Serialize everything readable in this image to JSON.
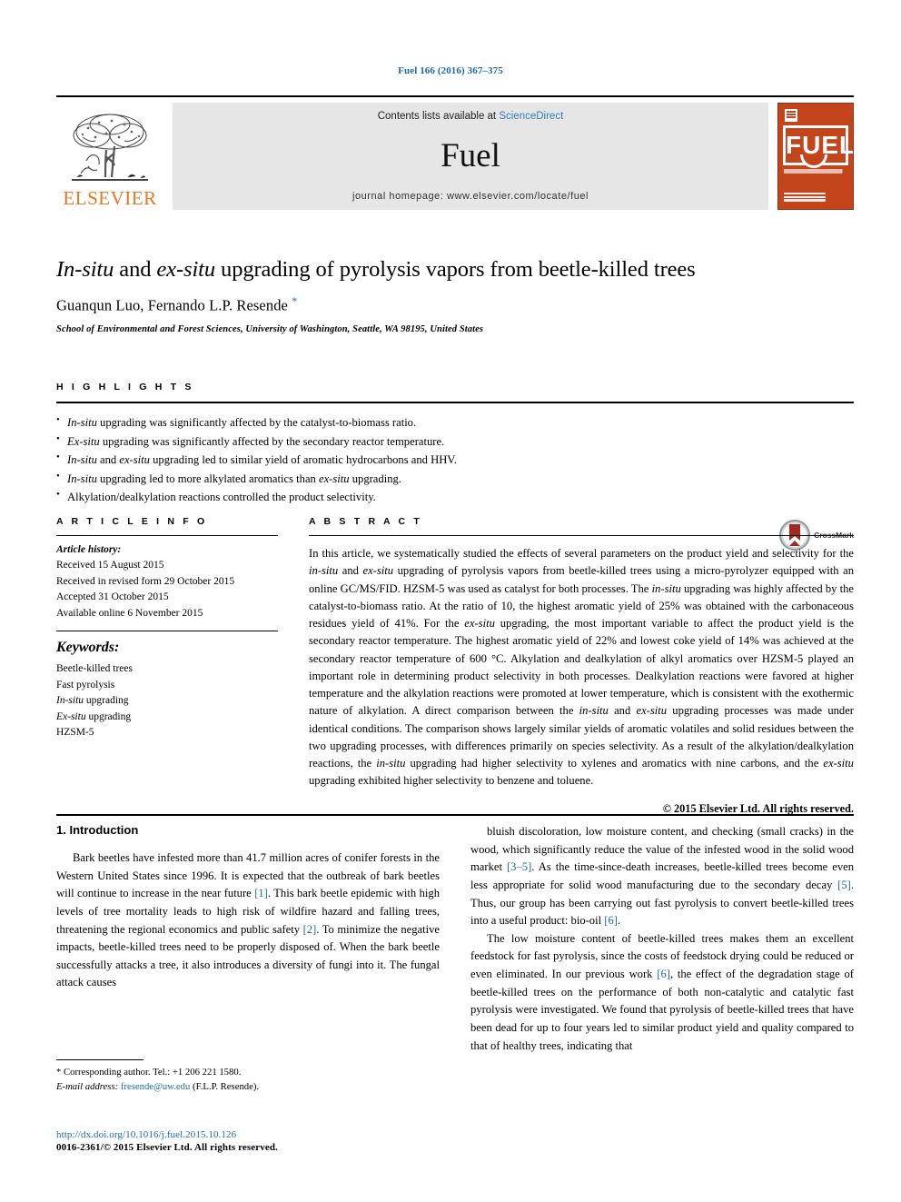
{
  "running_head": "Fuel 166 (2016) 367–375",
  "masthead": {
    "publisher_name": "ELSEVIER",
    "contents_prefix": "Contents lists available at ",
    "contents_link": "ScienceDirect",
    "journal_name": "Fuel",
    "homepage": "journal homepage: www.elsevier.com/locate/fuel",
    "cover_word": "FUEL"
  },
  "title": {
    "html": "<em>In-situ</em> and <em>ex-situ</em> upgrading of pyrolysis vapors from beetle-killed trees",
    "plain": "In-situ and ex-situ upgrading of pyrolysis vapors from beetle-killed trees"
  },
  "authors": {
    "html": "Guanqun Luo, Fernando L.P. Resende <sup>*</sup>",
    "plain": "Guanqun Luo, Fernando L.P. Resende *"
  },
  "affiliation": "School of Environmental and Forest Sciences, University of Washington, Seattle, WA 98195, United States",
  "crossmark_label": "CrossMark",
  "highlights": {
    "heading": "H I G H L I G H T S",
    "items": [
      "<em>In-situ</em> upgrading was significantly affected by the catalyst-to-biomass ratio.",
      "<em>Ex-situ</em> upgrading was significantly affected by the secondary reactor temperature.",
      "<em>In-situ</em> and <em>ex-situ</em> upgrading led to similar yield of aromatic hydrocarbons and HHV.",
      "<em>In-situ</em> upgrading led to more alkylated aromatics than <em>ex-situ</em> upgrading.",
      "Alkylation/dealkylation reactions controlled the product selectivity."
    ]
  },
  "article_info": {
    "heading": "A R T I C L E   I N F O",
    "history_label": "Article history:",
    "history": [
      "Received 15 August 2015",
      "Received in revised form 29 October 2015",
      "Accepted 31 October 2015",
      "Available online 6 November 2015"
    ],
    "keywords_label": "Keywords:",
    "keywords_html": [
      "Beetle-killed trees",
      "Fast pyrolysis",
      "<em>In-situ</em> upgrading",
      "<em>Ex-situ</em> upgrading",
      "HZSM-5"
    ]
  },
  "abstract": {
    "heading": "A B S T R A C T",
    "text_html": "In this article, we systematically studied the effects of several parameters on the product yield and selectivity for the <em>in-situ</em> and <em>ex-situ</em> upgrading of pyrolysis vapors from beetle-killed trees using a micro-pyrolyzer equipped with an online GC/MS/FID. HZSM-5 was used as catalyst for both processes. The <em>in-situ</em> upgrading was highly affected by the catalyst-to-biomass ratio. At the ratio of 10, the highest aromatic yield of 25% was obtained with the carbonaceous residues yield of 41%. For the <em>ex-situ</em> upgrading, the most important variable to affect the product yield is the secondary reactor temperature. The highest aromatic yield of 22% and lowest coke yield of 14% was achieved at the secondary reactor temperature of 600 °C. Alkylation and dealkylation of alkyl aromatics over HZSM-5 played an important role in determining product selectivity in both processes. Dealkylation reactions were favored at higher temperature and the alkylation reactions were promoted at lower temperature, which is consistent with the exothermic nature of alkylation. A direct comparison between the <em>in-situ</em> and <em>ex-situ</em> upgrading processes was made under identical conditions. The comparison shows largely similar yields of aromatic volatiles and solid residues between the two upgrading processes, with differences primarily on species selectivity. As a result of the alkylation/dealkylation reactions, the <em>in-situ</em> upgrading had higher selectivity to xylenes and aromatics with nine carbons, and the <em>ex-situ</em> upgrading exhibited higher selectivity to benzene and toluene.",
    "copyright": "© 2015 Elsevier Ltd. All rights reserved."
  },
  "introduction": {
    "heading": "1. Introduction",
    "left_paragraphs_html": [
      "Bark beetles have infested more than 41.7 million acres of conifer forests in the Western United States since 1996. It is expected that the outbreak of bark beetles will continue to increase in the near future <span class=\"ref\">[1]</span>. This bark beetle epidemic with high levels of tree mortality leads to high risk of wildfire hazard and falling trees, threatening the regional economics and public safety <span class=\"ref\">[2]</span>. To minimize the negative impacts, beetle-killed trees need to be properly disposed of. When the bark beetle successfully attacks a tree, it also introduces a diversity of fungi into it. The fungal attack causes"
    ],
    "right_paragraphs_html": [
      "bluish discoloration, low moisture content, and checking (small cracks) in the wood, which significantly reduce the value of the infested wood in the solid wood market <span class=\"ref\">[3–5]</span>. As the time-since-death increases, beetle-killed trees become even less appropriate for solid wood manufacturing due to the secondary decay <span class=\"ref\">[5]</span>. Thus, our group has been carrying out fast pyrolysis to convert beetle-killed trees into a useful product: bio-oil <span class=\"ref\">[6]</span>.",
      "The low moisture content of beetle-killed trees makes them an excellent feedstock for fast pyrolysis, since the costs of feedstock drying could be reduced or even eliminated. In our previous work <span class=\"ref\">[6]</span>, the effect of the degradation stage of beetle-killed trees on the performance of both non-catalytic and catalytic fast pyrolysis were investigated. We found that pyrolysis of beetle-killed trees that have been dead for up to four years led to similar product yield and quality compared to that of healthy trees, indicating that"
    ]
  },
  "footnote": {
    "corresponding_html": "* Corresponding author. Tel.: +1 206 221 1580.",
    "email_html": "<em>E-mail address:</em> <span class=\"lnk\">fresende@uw.edu</span> (F.L.P. Resende)."
  },
  "doi": {
    "url": "http://dx.doi.org/10.1016/j.fuel.2015.10.126",
    "issn_line": "0016-2361/© 2015 Elsevier Ltd. All rights reserved."
  },
  "colors": {
    "link": "#1a6ba8",
    "elsevier_orange": "#E87722",
    "sciencedirect_blue": "#2f7fc1",
    "cover_orange": "#C4451C",
    "band_gray": "#e6e6e6"
  }
}
